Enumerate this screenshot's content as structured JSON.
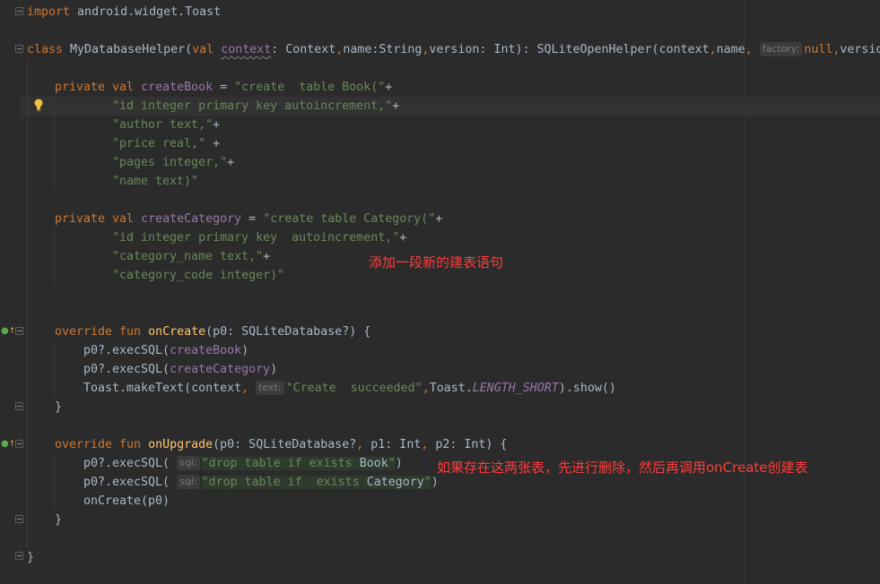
{
  "notes": {
    "create_category_note": "添加一段新的建表语句",
    "upgrade_note": "如果存在这两张表，先进行删除，然后再调用onCreate创建表"
  },
  "hints": {
    "factory": "factory:",
    "text": "text:",
    "sql": "sql:"
  },
  "code": {
    "import_kw": "import",
    "import_path": " android.widget.Toast",
    "class_kw": "class",
    "class_name": " MyDatabaseHelper(",
    "val_kw": "val",
    "context_param": "context",
    "class_params": ": Context",
    "comma1": ",",
    "name_param": "name:String",
    "comma2": ",",
    "version_param": "version: Int): SQLiteOpenHelper(context",
    "comma3": ",",
    "name_arg": "name",
    "comma4": ",",
    "null_kw": "null",
    "comma5": ",",
    "version_arg": "versio",
    "private1": "private val",
    "create_book": "createBook",
    "assign1": " = ",
    "str_create_book": "\"create  table Book(\"",
    "plus": "+",
    "str_id1": "\"id integer primary key autoincrement,\"",
    "str_author": "\"author text,\"",
    "str_price": "\"price real,\"",
    "plus_sp": " +",
    "str_pages": "\"pages integer,\"",
    "str_name": "\"name text)\"",
    "private2": "private val",
    "create_category": "createCategory",
    "assign2": " = ",
    "str_create_category": "\"create table Category(\"",
    "str_id2": "\"id integer primary key  autoincrement,\"",
    "str_category_name": "\"category_name text,\"",
    "str_category_code": "\"category_code integer)\"",
    "override1": "override fun",
    "on_create": "onCreate",
    "on_create_params": "(p0: SQLiteDatabase?) {",
    "exec1_pre": "p0?.execSQL(",
    "exec1_arg": "createBook",
    "exec1_post": ")",
    "exec2_pre": "p0?.execSQL(",
    "exec2_arg": "createCategory",
    "exec2_post": ")",
    "toast_pre": "Toast.makeText(context",
    "toast_comma": ",",
    "toast_str": "\"Create  succeeded\"",
    "toast_comma2": ",",
    "toast_cls": "Toast.",
    "toast_const": "LENGTH_SHORT",
    "toast_post": ").show()",
    "close_brace1": "}",
    "override2": "override fun",
    "on_upgrade": "onUpgrade",
    "on_upgrade_params_a": "(p0: SQLiteDatabase?",
    "on_upgrade_comma1": ",",
    "on_upgrade_params_b": " p1: Int",
    "on_upgrade_comma2": ",",
    "on_upgrade_params_c": " p2: Int) {",
    "drop1_pre": "p0?.execSQL(",
    "drop1_str_open": "\"drop table if exists ",
    "drop1_word": "Book",
    "drop1_str_close": "\"",
    "drop1_post": ")",
    "drop2_pre": "p0?.execSQL(",
    "drop2_str_open": "\"drop table if  exists ",
    "drop2_word": "Category",
    "drop2_str_close": "\"",
    "drop2_post": ")",
    "on_create_call": "onCreate(p0)",
    "close_brace2": "}",
    "close_brace_class": "}"
  }
}
